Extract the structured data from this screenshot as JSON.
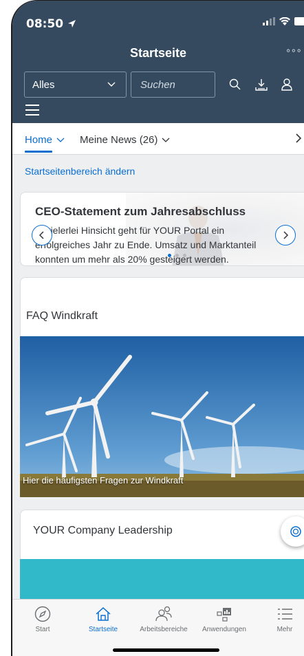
{
  "status": {
    "time": "08:50"
  },
  "header": {
    "title": "Startseite",
    "more_label": "∘∘∘",
    "scope_value": "Alles",
    "search_placeholder": "Suchen"
  },
  "tabs": [
    {
      "label": "Home"
    },
    {
      "label": "Meine News (26)"
    }
  ],
  "edit_link": "Startseitenbereich ändern",
  "ceo_card": {
    "title": "CEO-Statement zum Jahresabschluss",
    "body": "In vielerlei Hinsicht geht für YOUR Portal ein erfolgreiches Jahr zu Ende. Umsatz und Marktanteil konnten um mehr als 20% gesteigert werden."
  },
  "faq_card": {
    "title": "FAQ Windkraft",
    "caption": "Hier die häufigsten Fragen zur Windkraft"
  },
  "lead_card": {
    "title": "YOUR Company Leadership"
  },
  "tabbar": [
    {
      "label": "Start",
      "icon": "compass-icon"
    },
    {
      "label": "Startseite",
      "icon": "home-icon"
    },
    {
      "label": "Arbeitsbereiche",
      "icon": "people-icon"
    },
    {
      "label": "Anwendungen",
      "icon": "apps-icon"
    },
    {
      "label": "Mehr",
      "icon": "list-icon"
    }
  ],
  "colors": {
    "shell": "#354a5f",
    "accent": "#0a6ed1",
    "teal": "#31b8c9"
  }
}
